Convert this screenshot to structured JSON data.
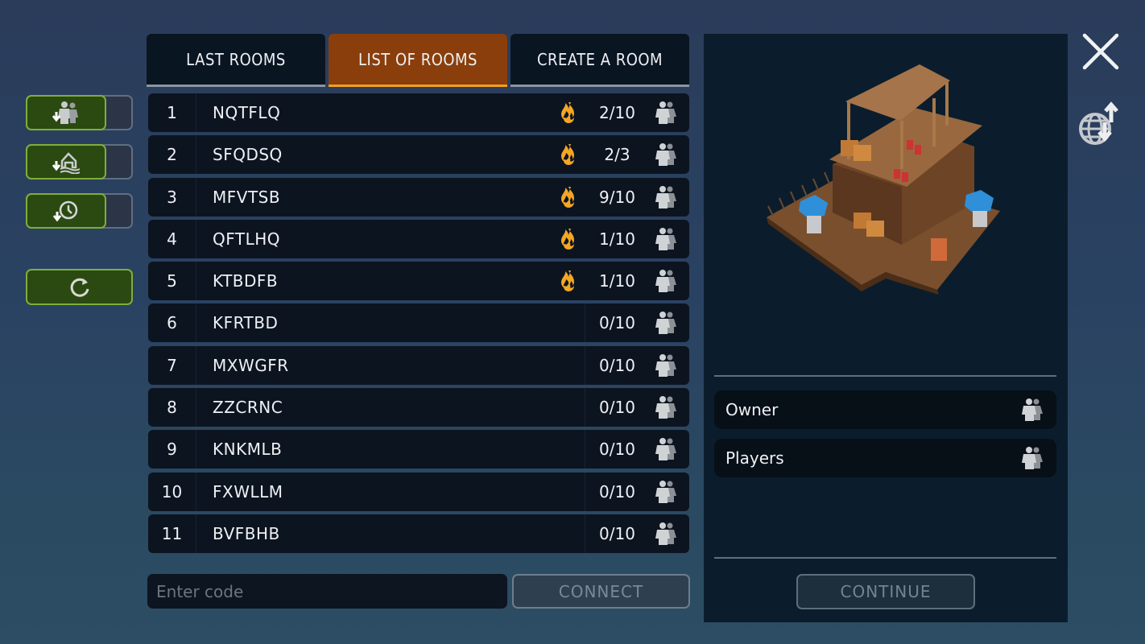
{
  "tabs": [
    {
      "label": "LAST ROOMS",
      "active": false
    },
    {
      "label": "LIST OF ROOMS",
      "active": true
    },
    {
      "label": "CREATE A ROOM",
      "active": false
    }
  ],
  "side_toggles": [
    {
      "icon": "download-players-icon",
      "state": "on"
    },
    {
      "icon": "download-house-icon",
      "state": "on"
    },
    {
      "icon": "download-history-icon",
      "state": "on"
    }
  ],
  "refresh": {
    "icon": "refresh-icon"
  },
  "rooms": [
    {
      "index": "1",
      "name": "NQTFLQ",
      "hot": true,
      "players": "2/10"
    },
    {
      "index": "2",
      "name": "SFQDSQ",
      "hot": true,
      "players": "2/3"
    },
    {
      "index": "3",
      "name": "MFVTSB",
      "hot": true,
      "players": "9/10"
    },
    {
      "index": "4",
      "name": "QFTLHQ",
      "hot": true,
      "players": "1/10"
    },
    {
      "index": "5",
      "name": "KTBDFB",
      "hot": true,
      "players": "1/10"
    },
    {
      "index": "6",
      "name": "KFRTBD",
      "hot": false,
      "players": "0/10"
    },
    {
      "index": "7",
      "name": "MXWGFR",
      "hot": false,
      "players": "0/10"
    },
    {
      "index": "8",
      "name": "ZZCRNC",
      "hot": false,
      "players": "0/10"
    },
    {
      "index": "9",
      "name": "KNKMLB",
      "hot": false,
      "players": "0/10"
    },
    {
      "index": "10",
      "name": "FXWLLM",
      "hot": false,
      "players": "0/10"
    },
    {
      "index": "11",
      "name": "BVFBHB",
      "hot": false,
      "players": "0/10"
    }
  ],
  "code_input": {
    "placeholder": "Enter code",
    "value": ""
  },
  "connect_label": "CONNECT",
  "details": {
    "owner_label": "Owner",
    "players_label": "Players",
    "continue_label": "CONTINUE"
  },
  "colors": {
    "active_tab": "#8a3e0c",
    "active_tab_underline": "#f0a020",
    "toggle_green": "#2b4a12",
    "toggle_border": "#7fae3a",
    "fire": "#f5a623"
  }
}
